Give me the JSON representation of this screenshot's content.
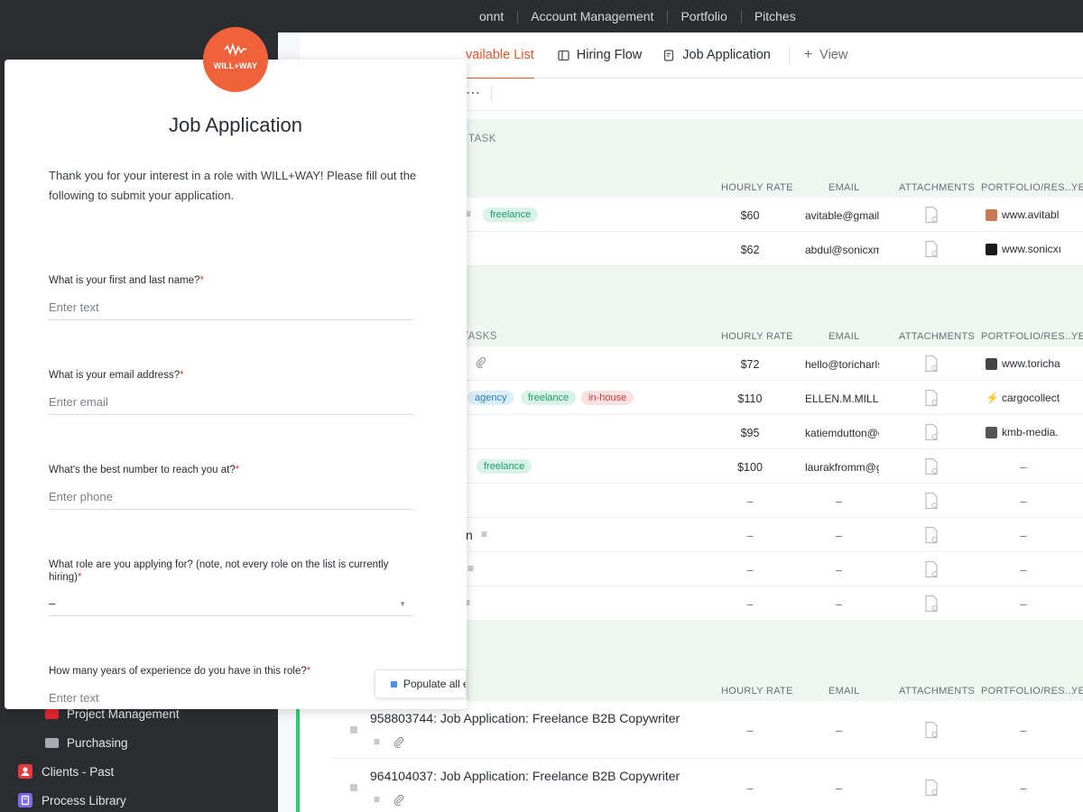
{
  "topnav": {
    "items": [
      "onnt",
      "Account Management",
      "Portfolio",
      "Pitches"
    ]
  },
  "tabs": {
    "items": [
      {
        "label": "vailable List",
        "icon": "list-icon"
      },
      {
        "label": "Hiring Flow",
        "icon": "board-icon"
      },
      {
        "label": "Job Application",
        "icon": "form-icon"
      }
    ],
    "view_label": "View"
  },
  "toolbar": {
    "more": "⋯"
  },
  "groups": [
    {
      "label": "TASK",
      "rows": [
        {
          "tags": [
            "freelance"
          ],
          "rate": "$60",
          "email": "avitable@gmail.",
          "portfolio": "www.avitabl"
        },
        {
          "tags": [],
          "rate": "$62",
          "email": "abdul@sonicxm",
          "portfolio": "www.sonicxı"
        }
      ]
    },
    {
      "label": "TASKS",
      "rows": [
        {
          "tags": [],
          "rate": "$72",
          "email": "hello@toricharls",
          "portfolio": "www.toricha"
        },
        {
          "tags": [
            "agency",
            "freelance",
            "in-house"
          ],
          "rate": "$110",
          "email": "ELLEN.M.MILLE",
          "portfolio": "cargocollect"
        },
        {
          "tags": [],
          "rate": "$95",
          "email": "katiemdutton@g",
          "portfolio": "kmb-media."
        },
        {
          "tags": [
            "freelance"
          ],
          "rate": "$100",
          "email": "laurakfromm@g",
          "portfolio": "–"
        },
        {
          "tags": [],
          "rate": "–",
          "email": "–",
          "portfolio": "–"
        },
        {
          "name_tail": "n",
          "tags": [],
          "rate": "–",
          "email": "–",
          "portfolio": "–"
        },
        {
          "tags": [],
          "rate": "–",
          "email": "–",
          "portfolio": "–"
        },
        {
          "tags": [],
          "rate": "–",
          "email": "–",
          "portfolio": "–"
        }
      ]
    },
    {
      "label": "",
      "rows": [
        {
          "name": "958803744: Job Application: Freelance B2B Copywriter",
          "rate": "–",
          "email": "–",
          "portfolio": "–"
        },
        {
          "name": "964104037: Job Application: Freelance B2B Copywriter",
          "rate": "–",
          "email": "–",
          "portfolio": "–"
        }
      ]
    }
  ],
  "columns": {
    "rate": "HOURLY RATE",
    "email": "EMAIL",
    "attachments": "ATTACHMENTS",
    "portfolio": "PORTFOLIO/RES...",
    "years": "YE"
  },
  "sidebar": {
    "items": [
      {
        "label": "Project Management",
        "icon": "folder-icon",
        "color": "#e0262e"
      },
      {
        "label": "Purchasing",
        "icon": "folder-icon",
        "color": "#a8abb0"
      },
      {
        "label": "Clients - Past",
        "icon": "user-icon",
        "color": "#e8383c"
      },
      {
        "label": "Process Library",
        "icon": "book-icon",
        "color": "#7b68ee"
      }
    ]
  },
  "form": {
    "brand": "WILL+WAY",
    "title": "Job Application",
    "description": "Thank you for your interest in a role with WILL+WAY! Please fill out the following to submit your application.",
    "questions": [
      {
        "label": "What is your first and last name?",
        "placeholder": "Enter text"
      },
      {
        "label": "What is your email address?",
        "placeholder": "Enter email"
      },
      {
        "label": "What's the best number to reach you at?",
        "placeholder": "Enter phone"
      },
      {
        "label": "What role are you applying for? (note, not every role on the list is currently hiring)",
        "value": "–"
      },
      {
        "label": "How many years of experience do you have in this role?",
        "placeholder": "Enter text"
      }
    ],
    "required_mark": "*"
  },
  "populate": {
    "label": "Populate all e"
  },
  "colors": {
    "accent": "#e8542d",
    "brand": "#f0623b",
    "group_band": "#eef7f2",
    "nav_bg": "#2b2d31"
  }
}
